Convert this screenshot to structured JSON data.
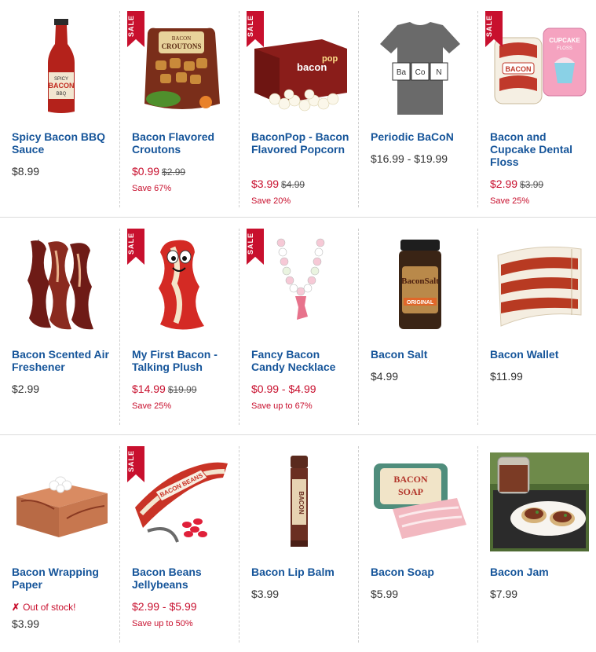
{
  "badge_label": "SALE",
  "products": [
    {
      "title": "Spicy Bacon BBQ Sauce",
      "price": "$8.99",
      "old_price": "",
      "save": "",
      "sale": false,
      "out_of_stock": ""
    },
    {
      "title": "Bacon Flavored Croutons",
      "price": "$0.99",
      "old_price": "$2.99",
      "save": "Save 67%",
      "sale": true,
      "out_of_stock": ""
    },
    {
      "title": "BaconPop - Bacon Flavored Popcorn",
      "price": "$3.99",
      "old_price": "$4.99",
      "save": "Save 20%",
      "sale": true,
      "out_of_stock": ""
    },
    {
      "title": "Periodic BaCoN",
      "price": "$16.99 - $19.99",
      "old_price": "",
      "save": "",
      "sale": false,
      "out_of_stock": ""
    },
    {
      "title": "Bacon and Cupcake Dental Floss",
      "price": "$2.99",
      "old_price": "$3.99",
      "save": "Save 25%",
      "sale": true,
      "out_of_stock": ""
    },
    {
      "title": "Bacon Scented Air Freshener",
      "price": "$2.99",
      "old_price": "",
      "save": "",
      "sale": false,
      "out_of_stock": ""
    },
    {
      "title": "My First Bacon - Talking Plush",
      "price": "$14.99",
      "old_price": "$19.99",
      "save": "Save 25%",
      "sale": true,
      "out_of_stock": ""
    },
    {
      "title": "Fancy Bacon Candy Necklace",
      "price": "$0.99 - $4.99",
      "old_price": "",
      "save": "Save up to 67%",
      "sale": true,
      "out_of_stock": ""
    },
    {
      "title": "Bacon Salt",
      "price": "$4.99",
      "old_price": "",
      "save": "",
      "sale": false,
      "out_of_stock": ""
    },
    {
      "title": "Bacon Wallet",
      "price": "$11.99",
      "old_price": "",
      "save": "",
      "sale": false,
      "out_of_stock": ""
    },
    {
      "title": "Bacon Wrapping Paper",
      "price": "$3.99",
      "old_price": "",
      "save": "",
      "sale": false,
      "out_of_stock": "Out of stock!"
    },
    {
      "title": "Bacon Beans Jellybeans",
      "price": "$2.99 - $5.99",
      "old_price": "",
      "save": "Save up to 50%",
      "sale": true,
      "out_of_stock": ""
    },
    {
      "title": "Bacon Lip Balm",
      "price": "$3.99",
      "old_price": "",
      "save": "",
      "sale": false,
      "out_of_stock": ""
    },
    {
      "title": "Bacon Soap",
      "price": "$5.99",
      "old_price": "",
      "save": "",
      "sale": false,
      "out_of_stock": ""
    },
    {
      "title": "Bacon Jam",
      "price": "$7.99",
      "old_price": "",
      "save": "",
      "sale": false,
      "out_of_stock": ""
    }
  ],
  "image_text": {
    "bbq": [
      "SPICY",
      "BACON",
      "BBQ"
    ],
    "croutons": [
      "BACON",
      "CROUTONS"
    ],
    "popcorn": [
      "bacon",
      "pop"
    ],
    "periodic": [
      "Ba",
      "Co",
      "N"
    ],
    "floss_bacon": "BACON",
    "floss_cupcake": [
      "CUPCAKE",
      "FLOSS"
    ],
    "salt": [
      "BaconSalt",
      "ORIGINAL"
    ],
    "beans": "BACON BEANS",
    "lipbalm": "BACON",
    "soap": [
      "BACON",
      "SOAP"
    ]
  },
  "colors": {
    "title_link": "#16559a",
    "sale_red": "#c8102e",
    "price_text": "#333333"
  }
}
